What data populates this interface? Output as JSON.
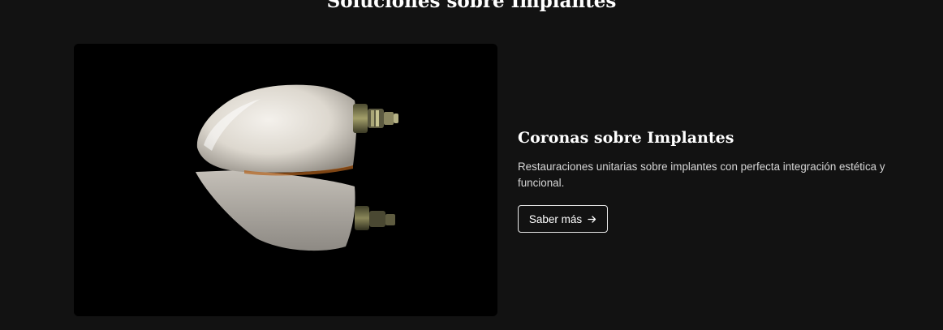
{
  "section": {
    "title": "Soluciones sobre Implantes"
  },
  "card": {
    "image_alt": "dental-crown-on-implant-photo",
    "title": "Coronas sobre Implantes",
    "description": "Restauraciones unitarias sobre implantes con perfecta integración estética y funcional.",
    "cta_label": "Saber más",
    "cta_icon": "arrow-right-icon"
  },
  "colors": {
    "background": "#121212",
    "text": "#ffffff",
    "muted_text": "#d6d6d6",
    "button_border": "#e9e9e9"
  }
}
